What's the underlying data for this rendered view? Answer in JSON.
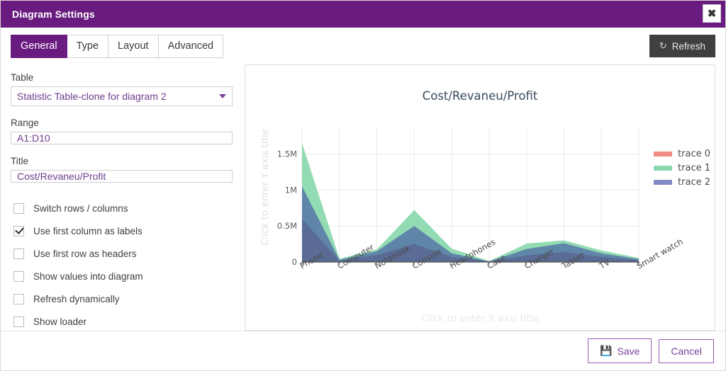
{
  "window": {
    "title": "Diagram Settings",
    "close_icon": "close-icon",
    "close_label": "✖"
  },
  "tabs": [
    {
      "label": "General",
      "active": true
    },
    {
      "label": "Type",
      "active": false
    },
    {
      "label": "Layout",
      "active": false
    },
    {
      "label": "Advanced",
      "active": false
    }
  ],
  "form": {
    "table_label": "Table",
    "table_value": "Statistic Table-clone for diagram 2",
    "range_label": "Range",
    "range_value": "A1:D10",
    "title_label": "Title",
    "title_value": "Cost/Revaneu/Profit",
    "checkboxes": [
      {
        "label": "Switch rows / columns",
        "checked": false
      },
      {
        "label": "Use first column as labels",
        "checked": true
      },
      {
        "label": "Use first row as headers",
        "checked": false
      },
      {
        "label": "Show values into diagram",
        "checked": false
      },
      {
        "label": "Refresh dynamically",
        "checked": false
      },
      {
        "label": "Show loader",
        "checked": false
      }
    ]
  },
  "toolbar": {
    "refresh_label": "Refresh",
    "refresh_icon": "refresh-icon",
    "refresh_icon_glyph": "↻"
  },
  "footer": {
    "save_label": "Save",
    "save_icon": "save-floppy-icon",
    "save_icon_glyph": "💾",
    "cancel_label": "Cancel"
  },
  "chart_data": {
    "type": "area",
    "title": "Cost/Revaneu/Profit",
    "xlabel": "Click to enter X axis title",
    "ylabel": "Click to enter Y axis title",
    "stacked": false,
    "grid": true,
    "legend_position": "right",
    "categories": [
      "Phone",
      "Computer",
      "Notebook",
      "Console",
      "Headphones",
      "Case",
      "Charger",
      "Tablet",
      "TV",
      "Smart watch"
    ],
    "ylim": [
      0,
      1750000
    ],
    "yticks": [
      0,
      500000,
      1000000,
      1500000
    ],
    "ytick_labels": [
      "0",
      "0.5M",
      "1M",
      "1.5M"
    ],
    "series": [
      {
        "name": "trace 0",
        "color": "#f08c85",
        "area_color": "#5a7fa8",
        "values": [
          1050000,
          30000,
          150000,
          500000,
          120000,
          8000,
          180000,
          260000,
          120000,
          40000
        ]
      },
      {
        "name": "trace 1",
        "color": "#8ad8ab",
        "area_color": "#8ad8ab",
        "values": [
          1650000,
          45000,
          175000,
          720000,
          185000,
          12000,
          255000,
          300000,
          160000,
          55000
        ]
      },
      {
        "name": "trace 2",
        "color": "#8289c4",
        "area_color": "#5a6a94",
        "values": [
          600000,
          18000,
          95000,
          250000,
          70000,
          5000,
          90000,
          140000,
          70000,
          25000
        ]
      }
    ]
  }
}
